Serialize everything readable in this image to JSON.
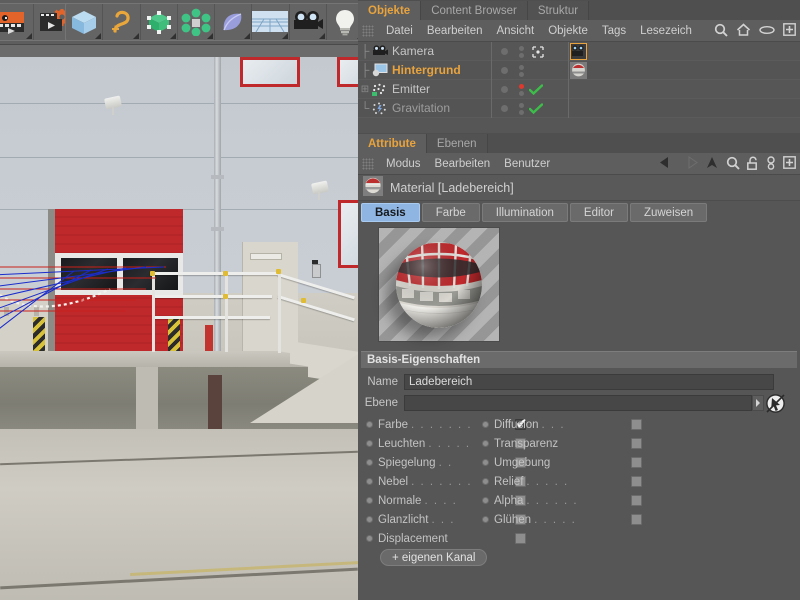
{
  "toolbar": {
    "buttons": [
      {
        "name": "render-view-button",
        "icon": "render-view-icon"
      },
      {
        "name": "render-settings-button",
        "icon": "render-settings-icon"
      },
      {
        "name": "primitive-cube-button",
        "icon": "cube-icon"
      },
      {
        "name": "spline-button",
        "icon": "spline-icon"
      },
      {
        "name": "nurbs-button",
        "icon": "hyper-nurbs-icon"
      },
      {
        "name": "array-button",
        "icon": "array-icon"
      },
      {
        "name": "deformer-button",
        "icon": "bend-deformer-icon"
      },
      {
        "name": "scene-floor-button",
        "icon": "floor-icon"
      },
      {
        "name": "camera-button",
        "icon": "camera-icon"
      },
      {
        "name": "light-button",
        "icon": "light-bulb-icon"
      }
    ]
  },
  "viewport": {
    "nav_icons": [
      "move-icon",
      "dolly-icon",
      "rotate-icon",
      "maximize-icon"
    ]
  },
  "object_manager": {
    "tabs": [
      {
        "label": "Objekte",
        "active": true
      },
      {
        "label": "Content Browser",
        "active": false
      },
      {
        "label": "Struktur",
        "active": false
      }
    ],
    "menus": [
      "Datei",
      "Bearbeiten",
      "Ansicht",
      "Objekte",
      "Tags",
      "Lesezeich"
    ],
    "icons": [
      "search-icon",
      "home-icon",
      "eye-icon",
      "plus-box-icon"
    ],
    "objects": [
      {
        "label": "Kamera",
        "icon": "camera-icon",
        "selected": false,
        "dimmed": false,
        "has_expand": false,
        "tag": "target-tag-icon",
        "material": "camera-thumb",
        "material_selected": true,
        "green_check": false,
        "red_dot": false
      },
      {
        "label": "Hintergrund",
        "icon": "background-icon",
        "selected": true,
        "dimmed": false,
        "has_expand": false,
        "tag": "",
        "material": "material-thumb",
        "material_selected": false,
        "green_check": false,
        "red_dot": false
      },
      {
        "label": "Emitter",
        "icon": "emitter-icon",
        "selected": false,
        "dimmed": false,
        "has_expand": true,
        "tag": "",
        "material": "",
        "material_selected": false,
        "green_check": true,
        "red_dot": true
      },
      {
        "label": "Gravitation",
        "icon": "gravitation-icon",
        "selected": false,
        "dimmed": true,
        "has_expand": false,
        "tag": "",
        "material": "",
        "material_selected": false,
        "green_check": true,
        "red_dot": false
      }
    ]
  },
  "attribute_manager": {
    "tabs": [
      {
        "label": "Attribute",
        "active": true
      },
      {
        "label": "Ebenen",
        "active": false
      }
    ],
    "menus": [
      "Modus",
      "Bearbeiten",
      "Benutzer"
    ],
    "icons": [
      "back-arrow-icon",
      "forward-arrow-icon",
      "up-arrow-icon",
      "search-icon",
      "unlock-icon",
      "link-icon",
      "plus-box-icon"
    ],
    "title": "Material [Ladebereich]",
    "title_icon": "material-sphere-icon",
    "property_tabs": [
      {
        "label": "Basis",
        "active": true
      },
      {
        "label": "Farbe",
        "active": false
      },
      {
        "label": "Illumination",
        "active": false
      },
      {
        "label": "Editor",
        "active": false
      },
      {
        "label": "Zuweisen",
        "active": false
      }
    ],
    "section_title": "Basis-Eigenschaften",
    "fields": [
      {
        "label": "Name",
        "value": "Ladebereich",
        "placeholder": ""
      },
      {
        "label": "Ebene",
        "value": "",
        "placeholder": ""
      }
    ],
    "layer_arrow_icon": "chevron-right-icon",
    "layer_pick_icon": "pick-cursor-icon",
    "channels_left": [
      {
        "label": "Farbe",
        "dots": ". . . . . . .",
        "checked": true
      },
      {
        "label": "Leuchten",
        "dots": ". . . . .",
        "checked": false
      },
      {
        "label": "Spiegelung",
        "dots": ". .",
        "checked": false
      },
      {
        "label": "Nebel",
        "dots": ". . . . . . .",
        "checked": false
      },
      {
        "label": "Normale",
        "dots": ". . . .",
        "checked": false
      },
      {
        "label": "Glanzlicht",
        "dots": ". . .",
        "checked": false
      },
      {
        "label": "Displacement",
        "dots": "",
        "checked": false
      }
    ],
    "channels_right": [
      {
        "label": "Diffusion",
        "dots": ". . .",
        "checked": false
      },
      {
        "label": "Transparenz",
        "dots": "",
        "checked": false
      },
      {
        "label": "Umgebung",
        "dots": "",
        "checked": false
      },
      {
        "label": "Relief",
        "dots": ". . . . .",
        "checked": false
      },
      {
        "label": "Alpha",
        "dots": ". . . . . .",
        "checked": false
      },
      {
        "label": "Glühen",
        "dots": ". . . . .",
        "checked": false
      }
    ],
    "add_channel_button": "+ eigenen Kanal"
  },
  "colors": {
    "accent_orange": "#e8a33d",
    "tab_active_blue": "#8fb6e2",
    "panel_bg": "#565656",
    "toolbar_bg": "#5e5e5e",
    "door_red": "#c0292c",
    "check_green": "#3dbd4a",
    "emitter_red": "#e0382c"
  }
}
